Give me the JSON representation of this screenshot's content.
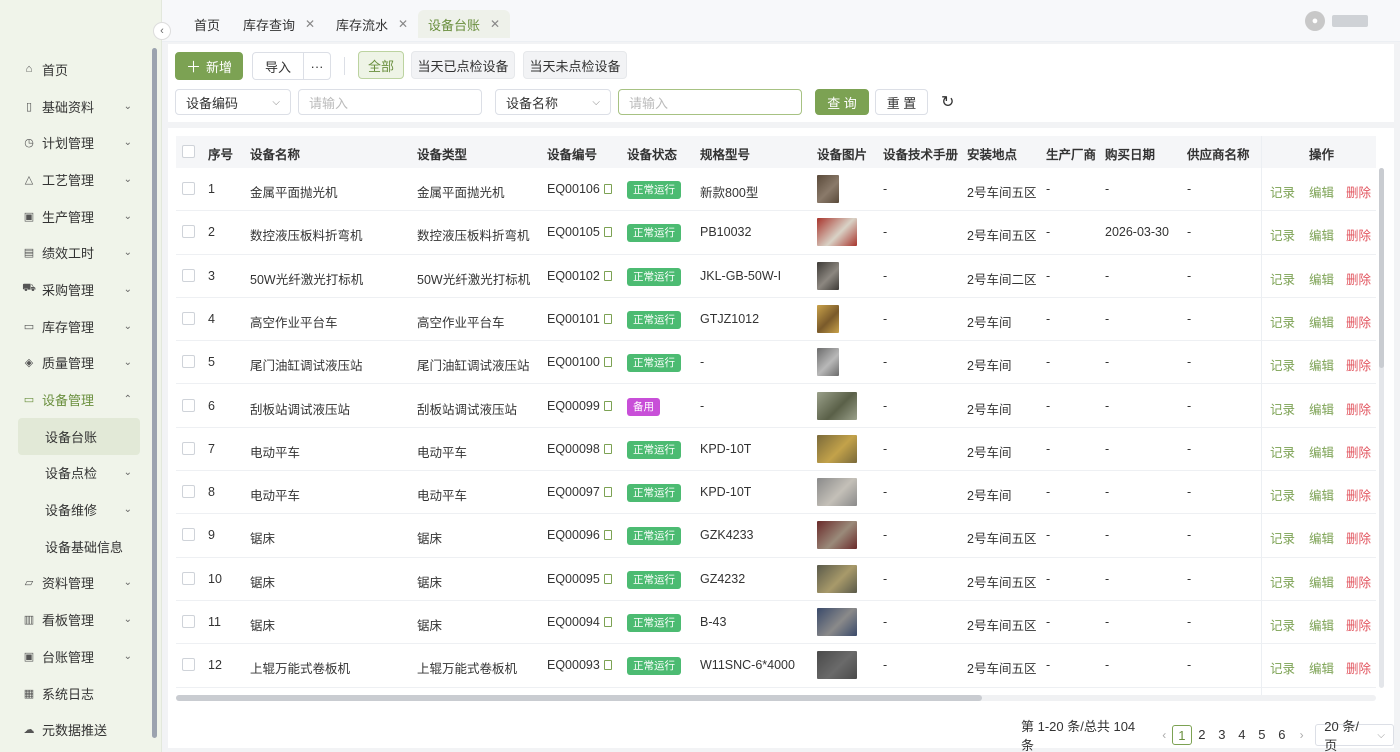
{
  "sidebar": {
    "items": [
      {
        "label": "首页",
        "icon": "home-icon",
        "glyph": "⌂",
        "chevron": false
      },
      {
        "label": "基础资料",
        "icon": "document-icon",
        "glyph": "▯",
        "chevron": true
      },
      {
        "label": "计划管理",
        "icon": "clock-icon",
        "glyph": "◷",
        "chevron": true
      },
      {
        "label": "工艺管理",
        "icon": "process-icon",
        "glyph": "△",
        "chevron": true
      },
      {
        "label": "生产管理",
        "icon": "production-icon",
        "glyph": "▣",
        "chevron": true
      },
      {
        "label": "绩效工时",
        "icon": "timesheet-icon",
        "glyph": "▤",
        "chevron": true
      },
      {
        "label": "采购管理",
        "icon": "cart-icon",
        "glyph": "⛟",
        "chevron": true
      },
      {
        "label": "库存管理",
        "icon": "inventory-icon",
        "glyph": "▭",
        "chevron": true
      },
      {
        "label": "质量管理",
        "icon": "shield-icon",
        "glyph": "◈",
        "chevron": true
      },
      {
        "label": "设备管理",
        "icon": "monitor-icon",
        "glyph": "▭",
        "chevron": true,
        "open": true
      }
    ],
    "sub_items": [
      {
        "label": "设备台账",
        "active": true,
        "chevron": false
      },
      {
        "label": "设备点检",
        "chevron": true
      },
      {
        "label": "设备维修",
        "chevron": true
      },
      {
        "label": "设备基础信息",
        "chevron": false
      }
    ],
    "items_after": [
      {
        "label": "资料管理",
        "icon": "folder-icon",
        "glyph": "▱",
        "chevron": true
      },
      {
        "label": "看板管理",
        "icon": "chart-icon",
        "glyph": "▥",
        "chevron": true
      },
      {
        "label": "台账管理",
        "icon": "ledger-icon",
        "glyph": "▣",
        "chevron": true
      },
      {
        "label": "系统日志",
        "icon": "log-icon",
        "glyph": "▦",
        "chevron": false
      },
      {
        "label": "元数据推送",
        "icon": "cloud-icon",
        "glyph": "☁",
        "chevron": false
      }
    ]
  },
  "tabs": [
    {
      "label": "首页",
      "closable": false
    },
    {
      "label": "库存查询",
      "closable": true
    },
    {
      "label": "库存流水",
      "closable": true
    },
    {
      "label": "设备台账",
      "closable": true,
      "active": true
    }
  ],
  "toolbar": {
    "add_label": "新增",
    "import_label": "导入",
    "more_label": "···",
    "filters": [
      "全部",
      "当天已点检设备",
      "当天未点检设备"
    ],
    "search1_field": "设备编码",
    "search1_placeholder": "请输入",
    "search2_field": "设备名称",
    "search2_placeholder": "请输入",
    "query_label": "查 询",
    "reset_label": "重 置"
  },
  "table": {
    "headers": [
      "序号",
      "设备名称",
      "设备类型",
      "设备编号",
      "设备状态",
      "规格型号",
      "设备图片",
      "设备技术手册",
      "安装地点",
      "生产厂商",
      "购买日期",
      "供应商名称",
      "操作"
    ],
    "rows": [
      {
        "no": "1",
        "name": "金属平面抛光机",
        "type": "金属平面抛光机",
        "code": "EQ00106",
        "status": "正常运行",
        "model": "新款800型",
        "manual": "-",
        "location": "2号车间五区",
        "maker": "-",
        "date": "-",
        "supplier": "-"
      },
      {
        "no": "2",
        "name": "数控液压板料折弯机",
        "type": "数控液压板料折弯机",
        "code": "EQ00105",
        "status": "正常运行",
        "model": "PB10032",
        "manual": "-",
        "location": "2号车间五区",
        "maker": "-",
        "date": "2026-03-30",
        "supplier": "-"
      },
      {
        "no": "3",
        "name": "50W光纤激光打标机",
        "type": "50W光纤激光打标机",
        "code": "EQ00102",
        "status": "正常运行",
        "model": "JKL-GB-50W-I",
        "manual": "-",
        "location": "2号车间二区",
        "maker": "-",
        "date": "-",
        "supplier": "-"
      },
      {
        "no": "4",
        "name": "高空作业平台车",
        "type": "高空作业平台车",
        "code": "EQ00101",
        "status": "正常运行",
        "model": "GTJZ1012",
        "manual": "-",
        "location": "2号车间",
        "maker": "-",
        "date": "-",
        "supplier": "-"
      },
      {
        "no": "5",
        "name": "尾门油缸调试液压站",
        "type": "尾门油缸调试液压站",
        "code": "EQ00100",
        "status": "正常运行",
        "model": "-",
        "manual": "-",
        "location": "2号车间",
        "maker": "-",
        "date": "-",
        "supplier": "-"
      },
      {
        "no": "6",
        "name": "刮板站调试液压站",
        "type": "刮板站调试液压站",
        "code": "EQ00099",
        "status": "备用",
        "model": "-",
        "manual": "-",
        "location": "2号车间",
        "maker": "-",
        "date": "-",
        "supplier": "-"
      },
      {
        "no": "7",
        "name": "电动平车",
        "type": "电动平车",
        "code": "EQ00098",
        "status": "正常运行",
        "model": "KPD-10T",
        "manual": "-",
        "location": "2号车间",
        "maker": "-",
        "date": "-",
        "supplier": "-"
      },
      {
        "no": "8",
        "name": "电动平车",
        "type": "电动平车",
        "code": "EQ00097",
        "status": "正常运行",
        "model": "KPD-10T",
        "manual": "-",
        "location": "2号车间",
        "maker": "-",
        "date": "-",
        "supplier": "-"
      },
      {
        "no": "9",
        "name": "锯床",
        "type": "锯床",
        "code": "EQ00096",
        "status": "正常运行",
        "model": "GZK4233",
        "manual": "-",
        "location": "2号车间五区",
        "maker": "-",
        "date": "-",
        "supplier": "-"
      },
      {
        "no": "10",
        "name": "锯床",
        "type": "锯床",
        "code": "EQ00095",
        "status": "正常运行",
        "model": "GZ4232",
        "manual": "-",
        "location": "2号车间五区",
        "maker": "-",
        "date": "-",
        "supplier": "-"
      },
      {
        "no": "11",
        "name": "锯床",
        "type": "锯床",
        "code": "EQ00094",
        "status": "正常运行",
        "model": "B-43",
        "manual": "-",
        "location": "2号车间五区",
        "maker": "-",
        "date": "-",
        "supplier": "-"
      },
      {
        "no": "12",
        "name": "上辊万能式卷板机",
        "type": "上辊万能式卷板机",
        "code": "EQ00093",
        "status": "正常运行",
        "model": "W11SNC-6*4000",
        "manual": "-",
        "location": "2号车间五区",
        "maker": "-",
        "date": "-",
        "supplier": "-"
      }
    ],
    "ops": [
      "记录",
      "编辑",
      "删除"
    ]
  },
  "pagination": {
    "summary": "第 1-20 条/总共 104 条",
    "pages": [
      "1",
      "2",
      "3",
      "4",
      "5",
      "6"
    ],
    "current": "1",
    "page_size": "20 条/页"
  },
  "colors": {
    "accent": "#7ca253",
    "status_normal": "#4cbb72",
    "status_spare": "#c84fd8",
    "danger": "#e2555f"
  }
}
